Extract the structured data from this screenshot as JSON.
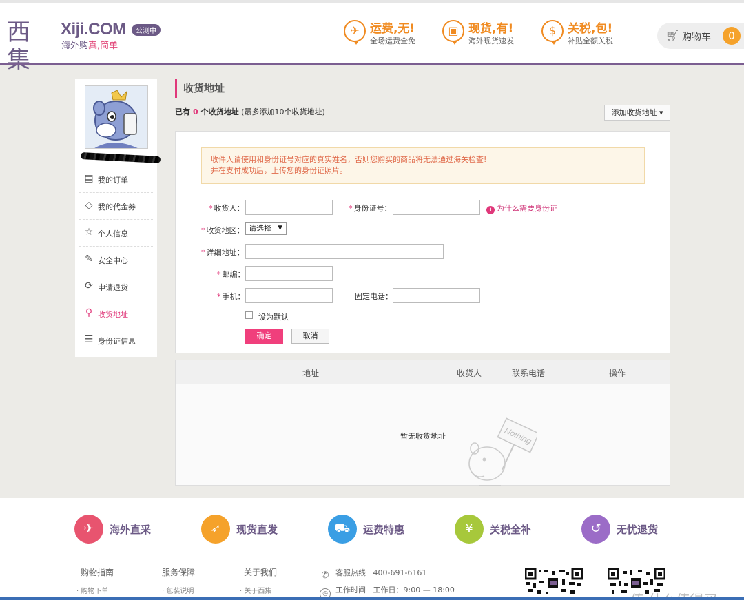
{
  "header": {
    "logo_cn": "西集",
    "logo_en": "Xiji.COM",
    "logo_sub_prefix": "海外购",
    "logo_sub_highlight": "真,简单",
    "beta": "公测中",
    "promos": [
      {
        "title": "运费,无!",
        "sub": "全场运费全免",
        "icon": "plane-icon"
      },
      {
        "title": "现货,有!",
        "sub": "海外现货速发",
        "icon": "box-icon"
      },
      {
        "title": "关税,包!",
        "sub": "补贴全额关税",
        "icon": "coin-icon"
      }
    ],
    "cart_label": "购物车",
    "cart_count": "0"
  },
  "sidebar": {
    "items": [
      {
        "label": "我的订单",
        "icon": "order-icon",
        "glyph": "▤",
        "active": false
      },
      {
        "label": "我的代金券",
        "icon": "coupon-icon",
        "glyph": "◇",
        "active": false
      },
      {
        "label": "个人信息",
        "icon": "star-icon",
        "glyph": "☆",
        "active": false
      },
      {
        "label": "安全中心",
        "icon": "edit-icon",
        "glyph": "✎",
        "active": false
      },
      {
        "label": "申请退货",
        "icon": "refresh-icon",
        "glyph": "⟳",
        "active": false
      },
      {
        "label": "收货地址",
        "icon": "location-icon",
        "glyph": "⚲",
        "active": true
      },
      {
        "label": "身份证信息",
        "icon": "id-card-icon",
        "glyph": "☰",
        "active": false
      }
    ]
  },
  "main": {
    "title": "收货地址",
    "count_prefix": "已有",
    "count": "0",
    "count_suffix": "个收货地址",
    "count_note": "(最多添加10个收货地址)",
    "add_button": "添加收货地址 ▾",
    "notice_line1": "收件人请使用和身份证号对应的真实姓名，否则您购买的商品将无法通过海关检查!",
    "notice_line2": "并在支付成功后，上传您的身份证照片。",
    "form": {
      "receiver_label": "收货人：",
      "id_label": "身份证号：",
      "why_id": "为什么需要身份证",
      "region_label": "收货地区：",
      "region_select": "请选择",
      "address_label": "详细地址：",
      "zip_label": "邮编：",
      "mobile_label": "手机：",
      "phone_label": "固定电话：",
      "default_label": "设为默认",
      "ok": "确定",
      "cancel": "取消"
    },
    "table": {
      "headers": [
        "地址",
        "收货人",
        "联系电话",
        "操作"
      ],
      "empty": "暂无收货地址",
      "sign_text": "Nothing"
    }
  },
  "footer": {
    "features": [
      {
        "label": "海外直采",
        "color": "#e8546f",
        "icon": "globe-bag-icon",
        "glyph": "✈"
      },
      {
        "label": "现货直发",
        "color": "#f5a22b",
        "icon": "rocket-icon",
        "glyph": "➶"
      },
      {
        "label": "运费特惠",
        "color": "#3a9ee4",
        "icon": "truck-icon",
        "glyph": "⛟"
      },
      {
        "label": "关税全补",
        "color": "#a7c83b",
        "icon": "piggy-icon",
        "glyph": "¥"
      },
      {
        "label": "无忧退货",
        "color": "#9b6cc7",
        "icon": "return-icon",
        "glyph": "↺"
      }
    ],
    "cols": [
      {
        "head": "购物指南",
        "item": "· 购物下单"
      },
      {
        "head": "服务保障",
        "item": "· 包装说明"
      },
      {
        "head": "关于我们",
        "item": "· 关于西集"
      }
    ],
    "hotline_label": "客服热线",
    "hotline": "400-691-6161",
    "hours_label": "工作时间",
    "hours": "工作日：9:00 — 18:00",
    "watermark": "值 什么值得买"
  }
}
